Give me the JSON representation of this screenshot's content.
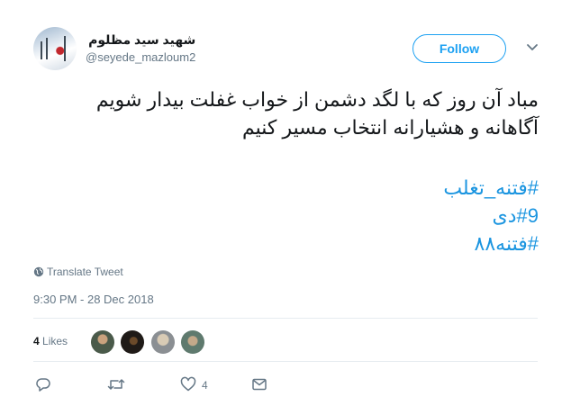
{
  "user": {
    "display_name": "شهید سید مظلوم",
    "handle": "@seyede_mazloum2"
  },
  "follow_label": "Follow",
  "tweet": {
    "lines": [
      "مباد آن روز که با لگد دشمن از خواب غفلت بیدار شویم",
      "آگاهانه و هشیارانه انتخاب مسیر کنیم"
    ],
    "hashtags": [
      "#فتنه_تغلب",
      "#9دی",
      "#فتنه۸۸"
    ]
  },
  "translate_label": "Translate Tweet",
  "timestamp": "9:30 PM - 28 Dec 2018",
  "stats": {
    "likes_count": "4",
    "likes_label": "Likes",
    "likers": [
      "#4a5a4a",
      "#1f1a17",
      "#8b8f93",
      "#5f7a6e"
    ]
  },
  "actions": {
    "reply_icon": "reply-icon",
    "retweet_icon": "retweet-icon",
    "like_icon": "heart-icon",
    "like_count": "4",
    "dm_icon": "envelope-icon"
  },
  "colors": {
    "accent": "#1da1f2",
    "hashtag": "#1b95e0",
    "muted": "#657786"
  }
}
